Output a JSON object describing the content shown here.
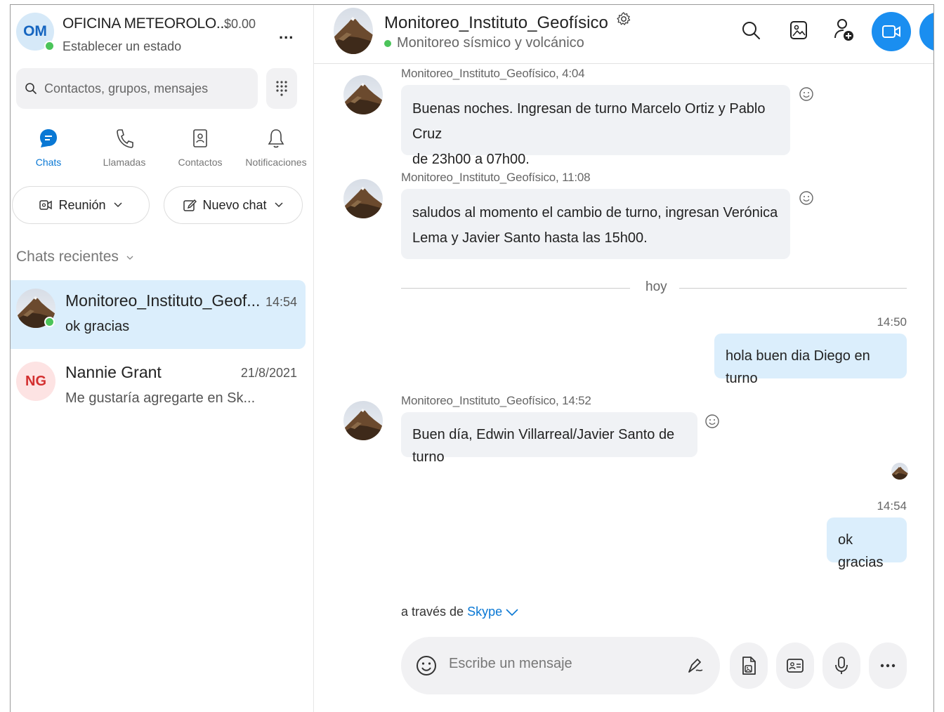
{
  "profile": {
    "initials": "OM",
    "name": "OFICINA METEOROLO...",
    "balance": "$0.00",
    "status": "Establecer un estado",
    "more": "..."
  },
  "search": {
    "placeholder": "Contactos, grupos, mensajes"
  },
  "nav": [
    {
      "label": "Chats",
      "icon": "chat-bubble-icon",
      "active": true
    },
    {
      "label": "Llamadas",
      "icon": "phone-icon"
    },
    {
      "label": "Contactos",
      "icon": "contacts-book-icon"
    },
    {
      "label": "Notificaciones",
      "icon": "bell-icon"
    }
  ],
  "actions": {
    "meeting": "Reunión",
    "new_chat": "Nuevo chat"
  },
  "recent": {
    "title": "Chats recientes",
    "chats": [
      {
        "name": "Monitoreo_Instituto_Geof...",
        "time": "14:54",
        "preview": "ok gracias",
        "selected": true
      },
      {
        "initials": "NG",
        "name": "Nannie Grant",
        "time": "21/8/2021",
        "preview": "Me gustaría agregarte en Sk..."
      }
    ]
  },
  "conversation": {
    "title": "Monitoreo_Instituto_Geofísico",
    "subtitle": "Monitoreo sísmico y volcánico",
    "messages": [
      {
        "meta": "Monitoreo_Instituto_Geofísico, 4:04",
        "line1": "Buenas noches. Ingresan de turno Marcelo Ortiz y Pablo Cruz",
        "line2": "de 23h00 a 07h00."
      },
      {
        "meta": "Monitoreo_Instituto_Geofísico, 11:08",
        "line1": "saludos al momento el cambio de turno, ingresan Verónica",
        "line2": "Lema y Javier Santo hasta las 15h00."
      },
      {
        "meta": "Monitoreo_Instituto_Geofísico, 14:52",
        "line1": "Buen día, Edwin Villarreal/Javier Santo de turno"
      }
    ],
    "divider": "hoy",
    "outgoing": [
      {
        "time": "14:50",
        "text": "hola buen dia Diego en turno"
      },
      {
        "time": "14:54",
        "text": "ok gracias"
      }
    ],
    "via_prefix": "a través de",
    "via_link": "Skype",
    "composer_placeholder": "Escribe un mensaje"
  },
  "colors": {
    "accent": "#1a8ef0",
    "link": "#0a78d4",
    "online": "#4bc45a",
    "selected_bg": "#dbeefc",
    "bubble_in": "#f0f2f5",
    "bubble_out": "#dbeefc"
  }
}
